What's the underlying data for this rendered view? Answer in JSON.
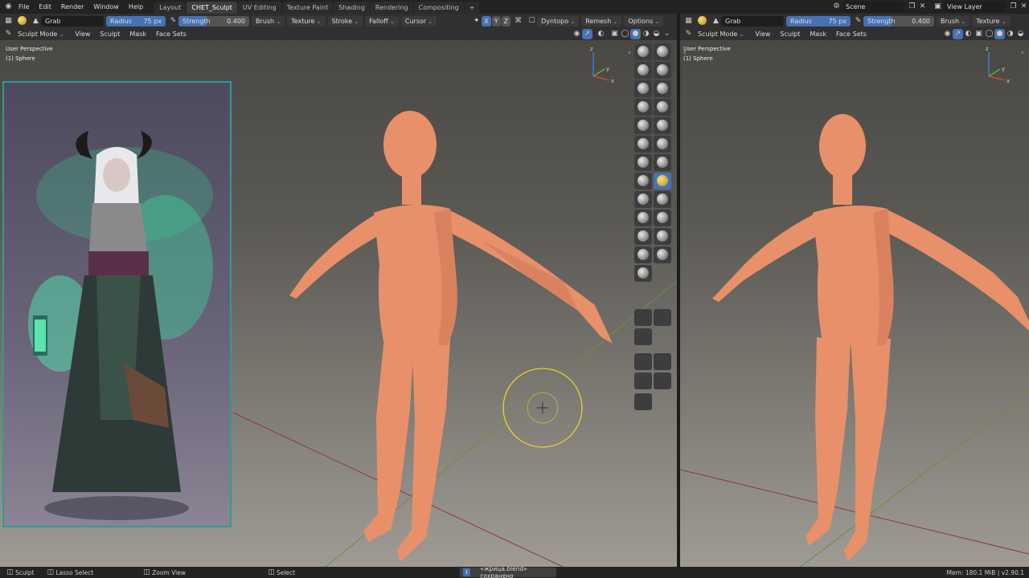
{
  "topbar": {
    "menus": [
      "File",
      "Edit",
      "Render",
      "Window",
      "Help"
    ],
    "workspace_tabs": [
      "Layout",
      "CHET_Sculpt",
      "UV Editing",
      "Texture Paint",
      "Shading",
      "Rendering",
      "Compositing"
    ],
    "active_tab": "CHET_Sculpt",
    "add_tab": "+",
    "scene": "Scene",
    "view_layer": "View Layer"
  },
  "left_header": {
    "brush_name": "Grab",
    "radius_label": "Radius",
    "radius_value": "75 px",
    "strength_label": "Strength",
    "strength_value": "0.400",
    "strength_fill": 0.4,
    "menus": [
      "Brush",
      "Texture",
      "Stroke",
      "Falloff",
      "Cursor"
    ],
    "axes": [
      "X",
      "Y",
      "Z"
    ],
    "dyntopo": "Dyntopo",
    "remesh": "Remesh",
    "options": "Options"
  },
  "right_header": {
    "brush_name": "Grab",
    "radius_label": "Radius",
    "radius_value": "75 px",
    "strength_label": "Strength",
    "strength_value": "0.400",
    "menus": [
      "Brush",
      "Texture"
    ]
  },
  "mode_header": {
    "mode": "Sculpt Mode",
    "menus": [
      "View",
      "Sculpt",
      "Mask",
      "Face Sets"
    ]
  },
  "viewport_left": {
    "perspective": "User Perspective",
    "object": "(1) Sphere"
  },
  "viewport_right": {
    "perspective": "User Perspective",
    "object": "(1) Sphere"
  },
  "status": {
    "sculpt": "Sculpt",
    "lasso": "Lasso Select",
    "zoom": "Zoom View",
    "select": "Select",
    "message": "«жрица.blend» сохранено",
    "memory": "Mem: 180.1 MiB | v2.90.1"
  },
  "colors": {
    "accent": "#4772b3",
    "skin": "#e8906a",
    "brush_circle": "#e3d32b"
  }
}
